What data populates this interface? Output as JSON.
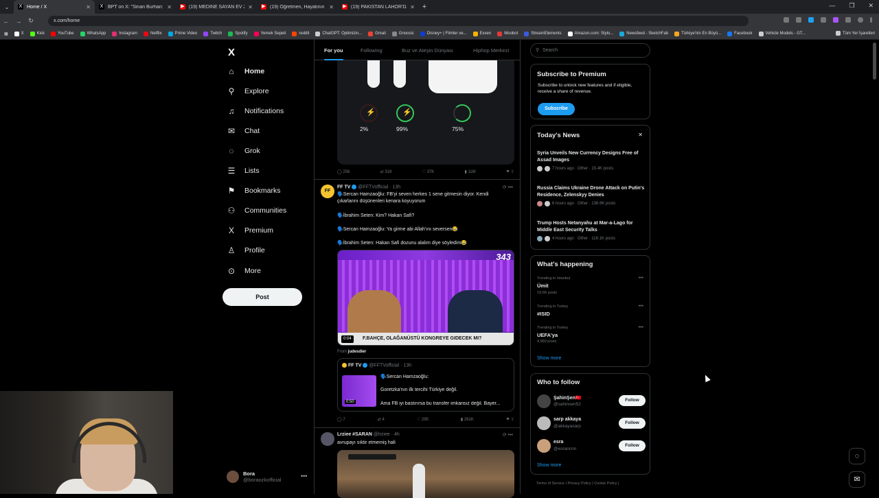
{
  "browser": {
    "tabs": [
      {
        "title": "Home / X",
        "color": "#000000",
        "glyph": "X"
      },
      {
        "title": "BPT on X: \"Sinan Burhan: \"Önü...",
        "color": "#000000",
        "glyph": "X"
      },
      {
        "title": "(19) MEDİNE SAYAN EV ZİYARE...",
        "color": "#ff0000",
        "glyph": "▶"
      },
      {
        "title": "(19) Öğretmen, Hayatının Bittiğ...",
        "color": "#ff0000",
        "glyph": "▶"
      },
      {
        "title": "(19) PAKİSTAN LAHOR'DA ŞOK...",
        "color": "#ff0000",
        "glyph": "▶"
      }
    ],
    "address": "x.com/home",
    "bookmarks": [
      {
        "label": "X",
        "color": "#ffffff"
      },
      {
        "label": "Kick",
        "color": "#53fc18"
      },
      {
        "label": "YouTube",
        "color": "#ff0000"
      },
      {
        "label": "WhatsApp",
        "color": "#25d366"
      },
      {
        "label": "Instagram",
        "color": "#e1306c"
      },
      {
        "label": "Netflix",
        "color": "#e50914"
      },
      {
        "label": "Prime Video",
        "color": "#00a8e1"
      },
      {
        "label": "Twitch",
        "color": "#9146ff"
      },
      {
        "label": "Spotify",
        "color": "#1db954"
      },
      {
        "label": "Yemek Sepeti",
        "color": "#fa0050"
      },
      {
        "label": "reddit",
        "color": "#ff4500"
      },
      {
        "label": "ChatGPT: Optimizin...",
        "color": "#cccccc"
      },
      {
        "label": "Gmail",
        "color": "#ea4335"
      },
      {
        "label": "Gnoosic",
        "color": "#888888"
      },
      {
        "label": "Disney+ | Filmler ve...",
        "color": "#113ccf"
      },
      {
        "label": "Exxen",
        "color": "#f5b400"
      },
      {
        "label": "Moobot",
        "color": "#e03b3b"
      },
      {
        "label": "StreamElements",
        "color": "#3b5bdb"
      },
      {
        "label": "Amazon.com: Stylo...",
        "color": "#ffffff"
      },
      {
        "label": "Newsfeed - SketchFab",
        "color": "#1caad9"
      },
      {
        "label": "Türkiye'nin En Büyü...",
        "color": "#f5a623"
      },
      {
        "label": "Facebook",
        "color": "#1877f2"
      },
      {
        "label": "Vehicle Models - GT...",
        "color": "#cccccc"
      }
    ],
    "all_bookmarks": "Tüm Yer İşaretleri"
  },
  "nav": {
    "items": [
      {
        "label": "Home",
        "icon": "home-icon",
        "glyph": "⌂"
      },
      {
        "label": "Explore",
        "icon": "search-icon",
        "glyph": "⚲"
      },
      {
        "label": "Notifications",
        "icon": "bell-icon",
        "glyph": "♫"
      },
      {
        "label": "Chat",
        "icon": "mail-icon",
        "glyph": "✉"
      },
      {
        "label": "Grok",
        "icon": "grok-icon",
        "glyph": "◌"
      },
      {
        "label": "Lists",
        "icon": "list-icon",
        "glyph": "☰"
      },
      {
        "label": "Bookmarks",
        "icon": "bookmark-icon",
        "glyph": "⚑"
      },
      {
        "label": "Communities",
        "icon": "people-icon",
        "glyph": "⚇"
      },
      {
        "label": "Premium",
        "icon": "x-icon",
        "glyph": "X"
      },
      {
        "label": "Profile",
        "icon": "person-icon",
        "glyph": "♙"
      },
      {
        "label": "More",
        "icon": "more-circle-icon",
        "glyph": "⊙"
      }
    ],
    "post_label": "Post",
    "me": {
      "name": "Bora",
      "handle": "@boraozkofficial"
    }
  },
  "feed": {
    "tabs": [
      "For you",
      "Following",
      "Buz ve Ateşin Dünyası",
      "Hiphop Merkezi"
    ],
    "airpods": {
      "left": "2%",
      "right": "99%",
      "case": "75%"
    },
    "post1_actions": {
      "replies": "256",
      "reposts": "318",
      "likes": "37K",
      "views": "11M"
    },
    "post2": {
      "name": "FF TV",
      "handle": "@FFTVofficial · 13h",
      "lines": [
        "🗣️Sercan Hamzaoğlu: FB'yi seven herkes 1 sene gitmesin diyor. Kendi çıkarlarını düşünenleri kenara koyuyorum",
        "🗣️İbrahim Seten: Kim? Hakan Safi?",
        "🗣️Sercan Hamzaoğlu: Ya girme abi Allah'ını seversen😂",
        "🗣️İbrahim Seten: Hakan Safi dozunu alalım diye söyledim😂"
      ],
      "video_number": "343",
      "video_time": "0:04",
      "video_caption": "F.BAHÇE, OLAĞANÜSTÜ KONGREYE GIDECEK MI?",
      "from_label": "From",
      "from_name": "judesdier",
      "quote": {
        "name": "FF TV",
        "handle": "@FFTVofficial · 13h",
        "line1": "🗣️Sercan Hamzaoğlu:",
        "line2": "Goretzka'nın ilk tercihi Türkiye değil.",
        "line3": "Ama FB iyi bastırırsa bu transfer imkansız değil. Bayer...",
        "time": "0:50"
      },
      "actions": {
        "replies": "7",
        "reposts": "4",
        "likes": "295",
        "views": "261K"
      }
    },
    "post3": {
      "name": "Lrziee #SARAN",
      "handle": "@lrziee · 4h",
      "text": "avrupayı sıktir etmemiş hali"
    }
  },
  "sidebar": {
    "search_placeholder": "Search",
    "premium": {
      "title": "Subscribe to Premium",
      "text": "Subscribe to unlock new features and if eligible, receive a share of revenue.",
      "button": "Subscribe"
    },
    "news": {
      "title": "Today's News",
      "items": [
        {
          "title": "Syria Unveils New Currency Designs Free of Assad Images",
          "meta": "7 hours ago · Other · 15.4K posts"
        },
        {
          "title": "Russia Claims Ukraine Drone Attack on Putin's Residence, Zelenskyy Denies",
          "meta": "6 hours ago · Other · 136.9K posts"
        },
        {
          "title": "Trump Hosts Netanyahu at Mar-a-Lago for Middle East Security Talks",
          "meta": "4 hours ago · Other · 116.1K posts"
        }
      ]
    },
    "happening": {
      "title": "What's happening",
      "items": [
        {
          "context": "Trending in Istanbul",
          "name": "Ümit",
          "posts": "19,5K posts"
        },
        {
          "context": "Trending in Turkey",
          "name": "#ISID",
          "posts": ""
        },
        {
          "context": "Trending in Turkey",
          "name": "UEFA'ya",
          "posts": "4,950 posts"
        }
      ],
      "show_more": "Show more"
    },
    "follow": {
      "title": "Who to follow",
      "items": [
        {
          "name": "ŞahinŞen🇹🇷",
          "handle": "@sahinsen52",
          "button": "Follow"
        },
        {
          "name": "sarp akkaya",
          "handle": "@akkayasarp",
          "button": "Follow"
        },
        {
          "name": "esra",
          "handle": "@esrancnn",
          "button": "Follow"
        }
      ],
      "show_more": "Show more"
    },
    "footer": "Terms of Service  |  Privacy Policy  |  Cookie Policy  |"
  }
}
